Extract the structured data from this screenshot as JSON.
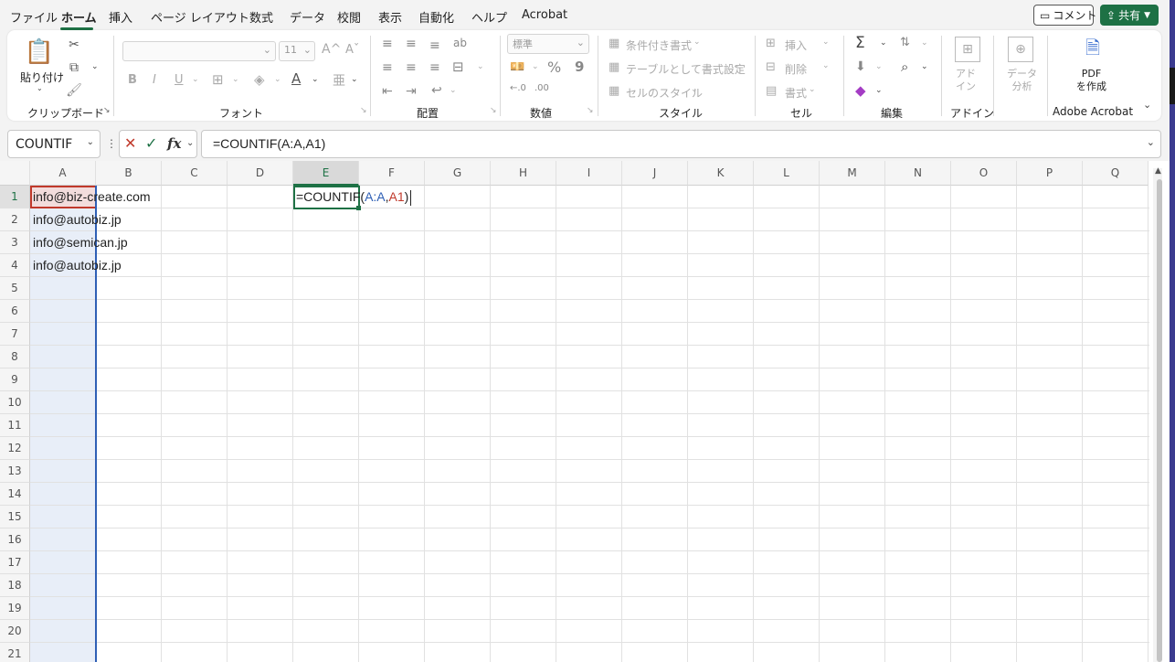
{
  "menu": {
    "tabs": [
      "ファイル",
      "ホーム",
      "挿入",
      "ページ レイアウト",
      "数式",
      "データ",
      "校閲",
      "表示",
      "自動化",
      "ヘルプ",
      "Acrobat"
    ],
    "active_tab": "ホーム",
    "comment_label": "コメント",
    "share_label": "共有"
  },
  "ribbon": {
    "clipboard": {
      "paste_label": "貼り付け",
      "group_label": "クリップボード"
    },
    "font": {
      "font_size": "11",
      "bold": "B",
      "italic": "I",
      "underline": "U",
      "grow_font": "A^",
      "shrink_font": "Aˇ",
      "group_label": "フォント"
    },
    "alignment": {
      "group_label": "配置"
    },
    "number": {
      "format_value": "標準",
      "percent": "%",
      "comma": "9",
      "group_label": "数値"
    },
    "styles": {
      "conditional_label": "条件付き書式",
      "table_label": "テーブルとして書式設定",
      "cell_style_label": "セルのスタイル",
      "group_label": "スタイル"
    },
    "cells": {
      "insert_label": "挿入",
      "delete_label": "削除",
      "format_label": "書式",
      "group_label": "セル"
    },
    "editing": {
      "group_label": "編集"
    },
    "addins": {
      "button_label": "アド\nイン",
      "group_label": "アドイン"
    },
    "data_analysis": {
      "button_label": "データ\n分析"
    },
    "acrobat": {
      "button_label": "PDF\nを作成",
      "group_label": "Adobe Acrobat"
    }
  },
  "formula_bar": {
    "name_box": "COUNTIF",
    "formula": "=COUNTIF(A:A,A1)"
  },
  "sheet": {
    "columns": [
      "A",
      "B",
      "C",
      "D",
      "E",
      "F",
      "G",
      "H",
      "I",
      "J",
      "K",
      "L",
      "M",
      "N",
      "O",
      "P",
      "Q"
    ],
    "active_column": "E",
    "rows": [
      "1",
      "2",
      "3",
      "4",
      "5",
      "6",
      "7",
      "8",
      "9",
      "10",
      "11",
      "12",
      "13",
      "14",
      "15",
      "16",
      "17",
      "18",
      "19",
      "20",
      "21"
    ],
    "cells_A": [
      "info@biz-create.com",
      "info@autobiz.jp",
      "info@semican.jp",
      "info@autobiz.jp"
    ],
    "edit_cell": {
      "prefix": "=COUNTIF(",
      "ref1": "A:A",
      "comma": ",",
      "ref2": "A1",
      "suffix": ")"
    },
    "colors": {
      "ref_blue": "#2e5fb5",
      "ref_red": "#c0392b",
      "accent": "#1e7145"
    }
  }
}
